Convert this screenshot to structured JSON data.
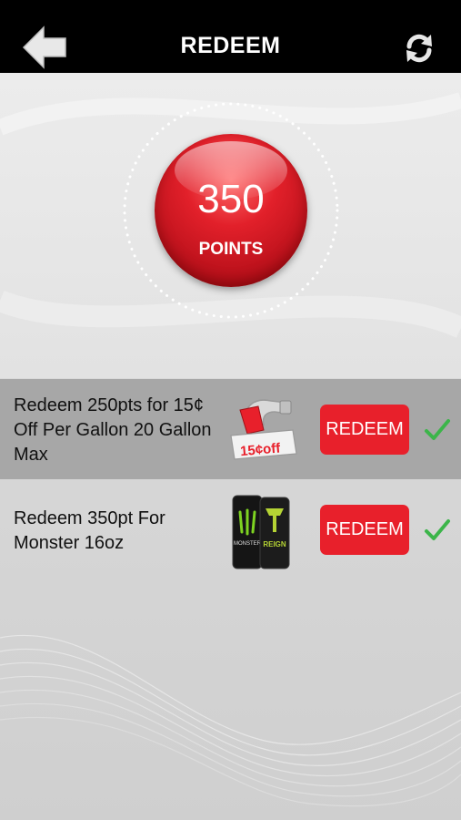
{
  "header": {
    "title": "REDEEM",
    "back_icon": "back-arrow-icon",
    "refresh_icon": "refresh-icon"
  },
  "points": {
    "value": "350",
    "label": "POINTS"
  },
  "offers": [
    {
      "description": "Redeem 250pts for 15¢ Off Per Gallon 20 Gallon Max",
      "image_text": "15¢off",
      "button_label": "REDEEM",
      "check_icon": "check-icon"
    },
    {
      "description": "Redeem 350pt For Monster 16oz",
      "can_labels": [
        "MONSTER",
        "REIGN"
      ],
      "button_label": "REDEEM",
      "check_icon": "check-icon"
    }
  ],
  "colors": {
    "header_bg": "#000000",
    "accent_red": "#e8202b",
    "check_green": "#3cb54a",
    "row_highlight": "#a7a7a7"
  }
}
